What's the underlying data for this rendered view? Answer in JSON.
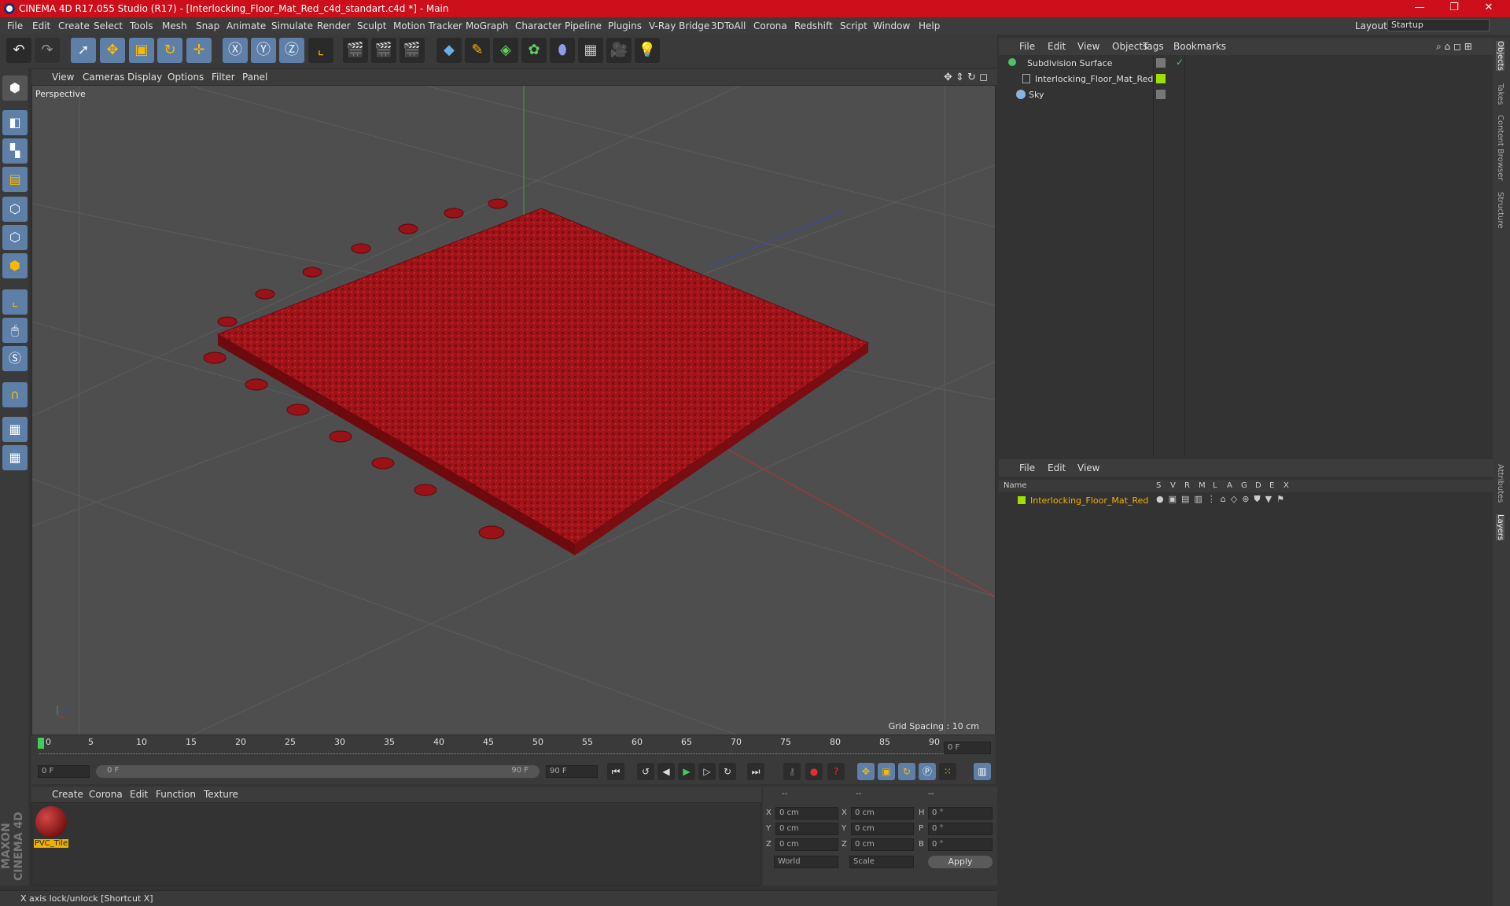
{
  "window": {
    "title": "CINEMA 4D R17.055 Studio (R17) - [Interlocking_Floor_Mat_Red_c4d_standart.c4d *] - Main"
  },
  "menubar": {
    "items": [
      "File",
      "Edit",
      "Create",
      "Select",
      "Tools",
      "Mesh",
      "Snap",
      "Animate",
      "Simulate",
      "Render",
      "Sculpt",
      "Motion Tracker",
      "MoGraph",
      "Character",
      "Pipeline",
      "Plugins",
      "V-Ray Bridge",
      "3DToAll",
      "Corona",
      "Redshift",
      "Script",
      "Window",
      "Help"
    ],
    "layout_label": "Layout:",
    "layout_value": "Startup"
  },
  "viewport": {
    "menu": [
      "View",
      "Cameras",
      "Display",
      "Options",
      "Filter",
      "Panel"
    ],
    "label": "Perspective",
    "grid_spacing": "Grid Spacing : 10 cm",
    "model_color": "#a01318"
  },
  "timeline": {
    "ticks": [
      "0",
      "5",
      "10",
      "15",
      "20",
      "25",
      "30",
      "35",
      "40",
      "45",
      "50",
      "55",
      "60",
      "65",
      "70",
      "75",
      "80",
      "85",
      "90"
    ],
    "current_frame": "0 F",
    "start_field": "0 F",
    "range_start": "0 F",
    "range_end": "90 F",
    "end_field": "90 F"
  },
  "materials": {
    "menu": [
      "Create",
      "Corona",
      "Edit",
      "Function",
      "Texture"
    ],
    "items": [
      {
        "name": "PVC_Tile",
        "color": "#8b1a1a"
      }
    ]
  },
  "coordinates": {
    "header": [
      "--",
      "--",
      "--"
    ],
    "rows": [
      {
        "a": "X",
        "v1": "0 cm",
        "b": "X",
        "v2": "0 cm",
        "c": "H",
        "v3": "0 °"
      },
      {
        "a": "Y",
        "v1": "0 cm",
        "b": "Y",
        "v2": "0 cm",
        "c": "P",
        "v3": "0 °"
      },
      {
        "a": "Z",
        "v1": "0 cm",
        "b": "Z",
        "v2": "0 cm",
        "c": "B",
        "v3": "0 °"
      }
    ],
    "mode1": "World",
    "mode2": "Scale",
    "apply": "Apply"
  },
  "status": "X axis lock/unlock [Shortcut X]",
  "objects_panel": {
    "menu": [
      "File",
      "Edit",
      "View",
      "Objects",
      "Tags",
      "Bookmarks"
    ],
    "objects": [
      {
        "name": "Subdivision Surface"
      },
      {
        "name": "Interlocking_Floor_Mat_Red"
      },
      {
        "name": "Sky"
      }
    ]
  },
  "layers_panel": {
    "menu": [
      "File",
      "Edit",
      "View"
    ],
    "columns": [
      "Name",
      "S",
      "V",
      "R",
      "M",
      "L",
      "A",
      "G",
      "D",
      "E",
      "X"
    ],
    "layers": [
      {
        "name": "Interlocking_Floor_Mat_Red",
        "color": "#e8b400"
      }
    ]
  },
  "side_tabs": [
    "Objects",
    "Takes",
    "Content Browser",
    "Structure",
    "Attributes",
    "Layers"
  ],
  "brand": "MAXON CINEMA 4D"
}
